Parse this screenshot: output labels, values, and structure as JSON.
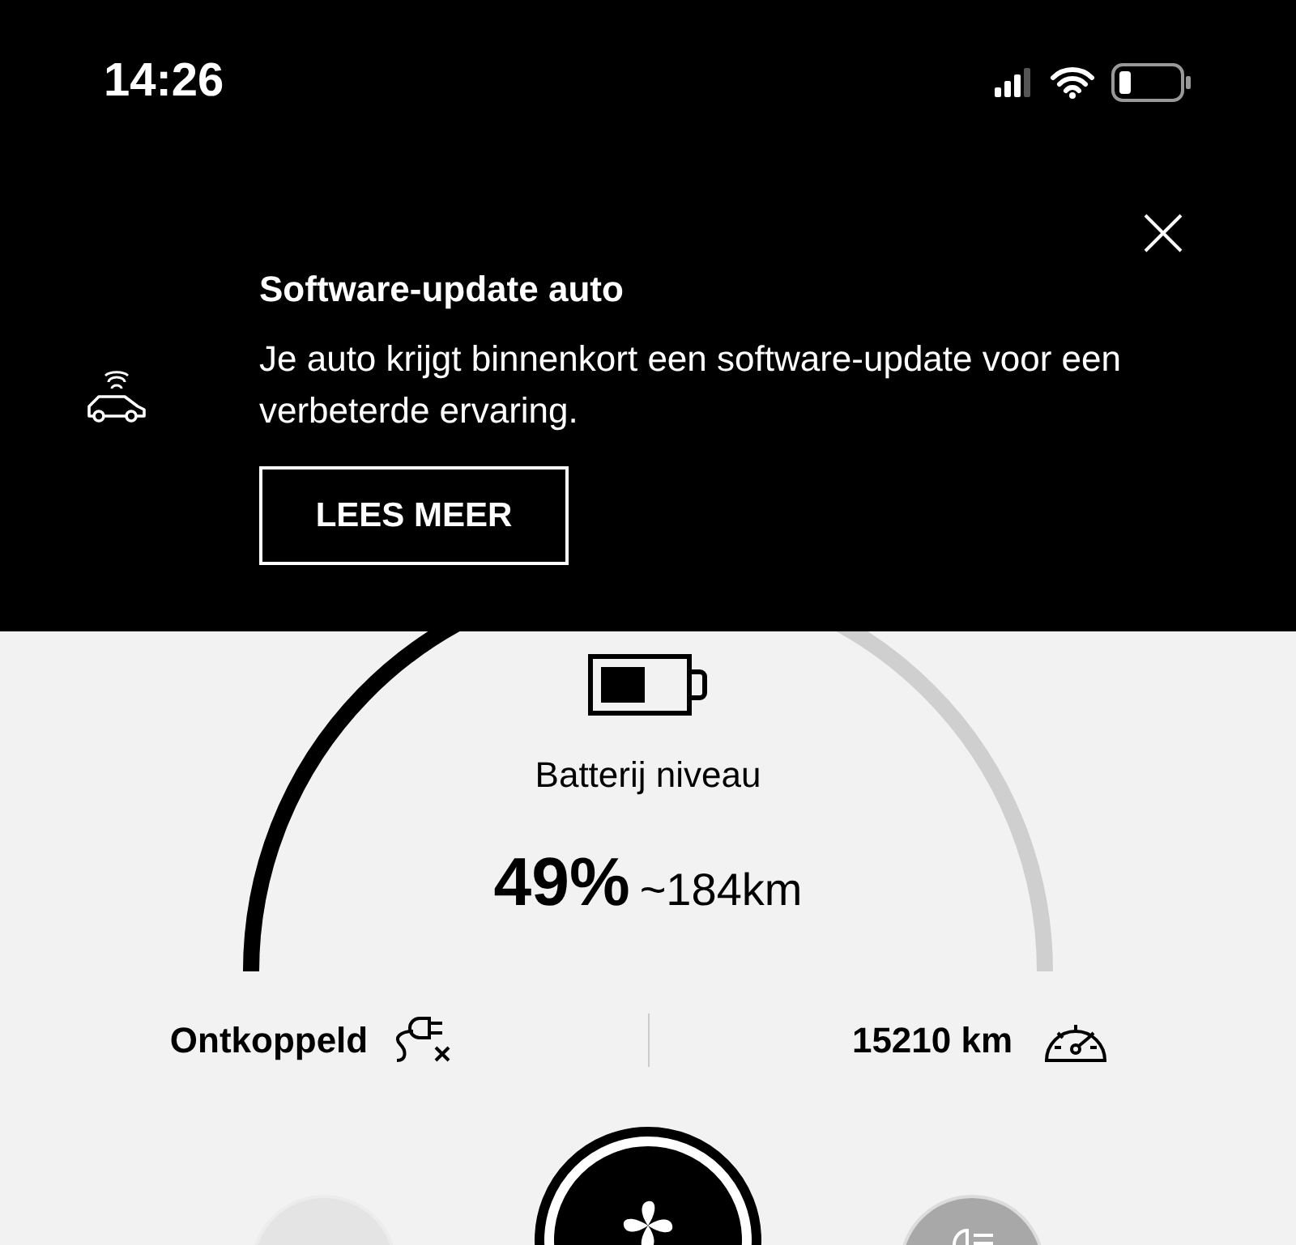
{
  "status_bar": {
    "time": "14:26"
  },
  "banner": {
    "title": "Software-update auto",
    "message": "Je auto krijgt binnenkort een software-update voor een verbeterde ervaring.",
    "button": "LEES MEER"
  },
  "battery": {
    "label": "Batterij niveau",
    "percent": "49%",
    "range": "~184km",
    "level": 0.49
  },
  "info": [
    {
      "kind": "charging",
      "text": "Ontkoppeld"
    },
    {
      "kind": "odometer",
      "text": "15210 km"
    }
  ],
  "controls": [
    {
      "kind": "blank",
      "active": false
    },
    {
      "kind": "fan",
      "active": true
    },
    {
      "kind": "lights",
      "active": false
    }
  ]
}
